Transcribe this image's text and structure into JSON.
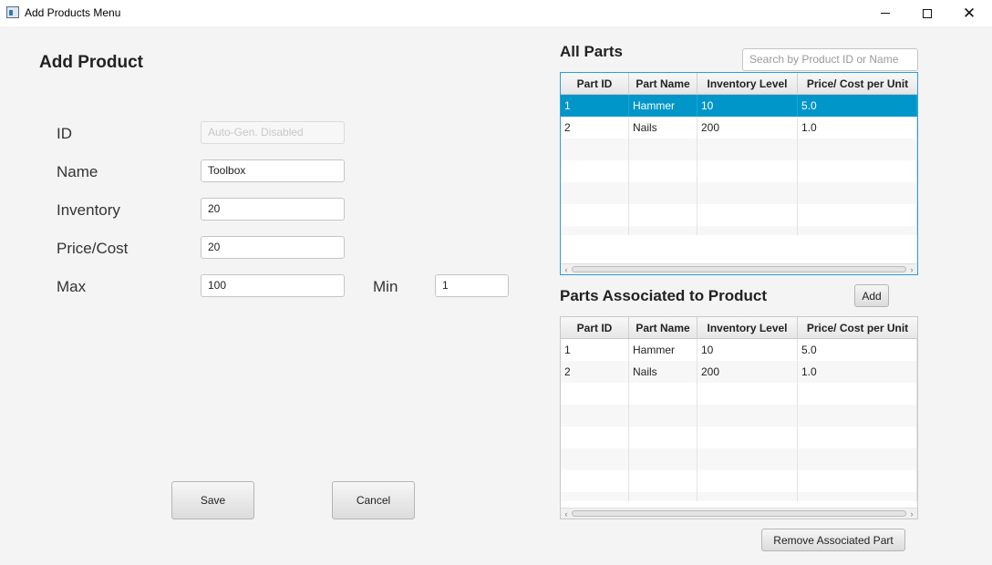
{
  "window": {
    "title": "Add Products Menu",
    "icon": "app-window-icon"
  },
  "form": {
    "heading": "Add Product",
    "id": {
      "label": "ID",
      "placeholder": "Auto-Gen. Disabled",
      "value": ""
    },
    "name": {
      "label": "Name",
      "value": "Toolbox"
    },
    "inventory": {
      "label": "Inventory",
      "value": "20"
    },
    "price": {
      "label": "Price/Cost",
      "value": "20"
    },
    "max": {
      "label": "Max",
      "value": "100"
    },
    "min": {
      "label": "Min",
      "value": "1"
    },
    "save_label": "Save",
    "cancel_label": "Cancel"
  },
  "all_parts": {
    "heading": "All Parts",
    "search_placeholder": "Search by Product ID or Name",
    "columns": [
      "Part ID",
      "Part Name",
      "Inventory Level",
      "Price/ Cost per Unit"
    ],
    "rows": [
      [
        "1",
        "Hammer",
        "10",
        "5.0"
      ],
      [
        "2",
        "Nails",
        "200",
        "1.0"
      ]
    ],
    "selected_row": 0
  },
  "associated_parts": {
    "heading": "Parts Associated to Product",
    "add_label": "Add",
    "columns": [
      "Part ID",
      "Part Name",
      "Inventory Level",
      "Price/ Cost per Unit"
    ],
    "rows": [
      [
        "1",
        "Hammer",
        "10",
        "5.0"
      ],
      [
        "2",
        "Nails",
        "200",
        "1.0"
      ]
    ],
    "remove_label": "Remove Associated Part"
  },
  "colors": {
    "selection": "#0096c9",
    "focus_border": "#2a9fd6",
    "background": "#f4f4f4"
  }
}
